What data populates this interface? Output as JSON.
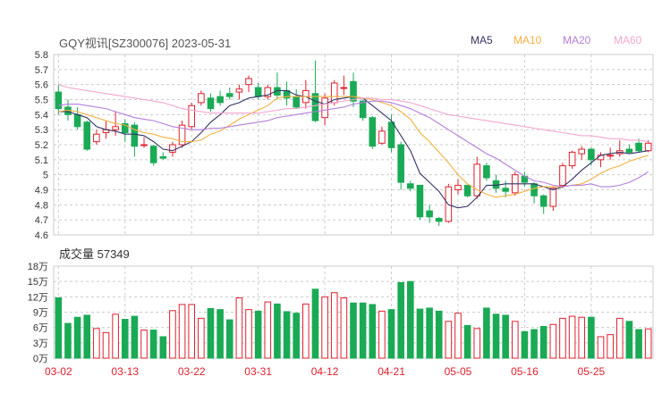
{
  "header": {
    "title": "GQY视讯[SZ300076] 2023-05-31",
    "ma_legend": [
      {
        "label": "MA5",
        "color": "#333366"
      },
      {
        "label": "MA10",
        "color": "#f5b041"
      },
      {
        "label": "MA20",
        "color": "#b57edc"
      },
      {
        "label": "MA60",
        "color": "#f4a6d0"
      }
    ]
  },
  "volume_header": {
    "label": "成交量 57349"
  },
  "colors": {
    "up": "#e0202e",
    "down": "#1aaa55",
    "grid": "#cccccc",
    "axis_text": "#333333",
    "date_text": "#e0202e"
  },
  "chart_data": [
    {
      "type": "candlestick",
      "title": "GQY视讯[SZ300076] 2023-05-31",
      "yticks": [
        "5.8",
        "5.7",
        "5.6",
        "5.5",
        "5.4",
        "5.3",
        "5.2",
        "5.1",
        "5",
        "4.9",
        "4.8",
        "4.7",
        "4.6"
      ],
      "ylim": [
        4.6,
        5.8
      ],
      "candles": [
        [
          5.55,
          5.44,
          5.6,
          5.4
        ],
        [
          5.45,
          5.4,
          5.5,
          5.36
        ],
        [
          5.4,
          5.32,
          5.45,
          5.3
        ],
        [
          5.35,
          5.17,
          5.36,
          5.16
        ],
        [
          5.22,
          5.27,
          5.3,
          5.2
        ],
        [
          5.28,
          5.3,
          5.36,
          5.24
        ],
        [
          5.3,
          5.32,
          5.42,
          5.26
        ],
        [
          5.34,
          5.28,
          5.37,
          5.22
        ],
        [
          5.33,
          5.19,
          5.35,
          5.12
        ],
        [
          5.2,
          5.2,
          5.25,
          5.18
        ],
        [
          5.19,
          5.08,
          5.2,
          5.06
        ],
        [
          5.12,
          5.11,
          5.15,
          5.1
        ],
        [
          5.15,
          5.2,
          5.22,
          5.12
        ],
        [
          5.2,
          5.33,
          5.36,
          5.18
        ],
        [
          5.32,
          5.46,
          5.48,
          5.3
        ],
        [
          5.48,
          5.54,
          5.56,
          5.46
        ],
        [
          5.51,
          5.44,
          5.54,
          5.42
        ],
        [
          5.52,
          5.48,
          5.56,
          5.46
        ],
        [
          5.54,
          5.52,
          5.58,
          5.5
        ],
        [
          5.55,
          5.57,
          5.6,
          5.5
        ],
        [
          5.6,
          5.64,
          5.66,
          5.55
        ],
        [
          5.58,
          5.52,
          5.61,
          5.5
        ],
        [
          5.52,
          5.58,
          5.6,
          5.5
        ],
        [
          5.58,
          5.53,
          5.68,
          5.5
        ],
        [
          5.56,
          5.51,
          5.62,
          5.46
        ],
        [
          5.52,
          5.45,
          5.57,
          5.44
        ],
        [
          5.48,
          5.56,
          5.63,
          5.44
        ],
        [
          5.54,
          5.36,
          5.76,
          5.35
        ],
        [
          5.38,
          5.51,
          5.54,
          5.33
        ],
        [
          5.48,
          5.61,
          5.63,
          5.46
        ],
        [
          5.58,
          5.58,
          5.66,
          5.53
        ],
        [
          5.62,
          5.49,
          5.68,
          5.45
        ],
        [
          5.49,
          5.38,
          5.5,
          5.36
        ],
        [
          5.38,
          5.19,
          5.39,
          5.17
        ],
        [
          5.21,
          5.29,
          5.32,
          5.2
        ],
        [
          5.35,
          5.18,
          5.4,
          5.15
        ],
        [
          5.2,
          4.95,
          5.22,
          4.9
        ],
        [
          4.94,
          4.91,
          4.96,
          4.89
        ],
        [
          4.93,
          4.72,
          4.93,
          4.7
        ],
        [
          4.76,
          4.72,
          4.8,
          4.68
        ],
        [
          4.71,
          4.69,
          4.72,
          4.66
        ],
        [
          4.69,
          4.92,
          4.94,
          4.68
        ],
        [
          4.9,
          4.93,
          4.97,
          4.87
        ],
        [
          4.93,
          4.86,
          4.93,
          4.85
        ],
        [
          4.86,
          5.07,
          5.12,
          4.84
        ],
        [
          5.06,
          4.98,
          5.08,
          4.96
        ],
        [
          4.96,
          4.91,
          5.0,
          4.88
        ],
        [
          4.91,
          4.89,
          4.96,
          4.85
        ],
        [
          4.88,
          5.0,
          5.02,
          4.86
        ],
        [
          4.99,
          4.95,
          5.02,
          4.92
        ],
        [
          4.94,
          4.86,
          4.95,
          4.81
        ],
        [
          4.86,
          4.79,
          4.87,
          4.74
        ],
        [
          4.79,
          4.91,
          4.92,
          4.76
        ],
        [
          4.93,
          5.06,
          5.08,
          4.91
        ],
        [
          5.06,
          5.15,
          5.16,
          5.04
        ],
        [
          5.14,
          5.17,
          5.19,
          5.1
        ],
        [
          5.17,
          5.1,
          5.18,
          5.06
        ],
        [
          5.1,
          5.13,
          5.15,
          5.05
        ],
        [
          5.13,
          5.13,
          5.18,
          5.1
        ],
        [
          5.14,
          5.16,
          5.23,
          5.12
        ],
        [
          5.17,
          5.15,
          5.2,
          5.14
        ],
        [
          5.21,
          5.16,
          5.24,
          5.15
        ],
        [
          5.16,
          5.21,
          5.23,
          5.15
        ]
      ],
      "ma5": [
        5.42,
        5.42,
        5.4,
        5.38,
        5.32,
        5.3,
        5.29,
        5.27,
        5.27,
        5.26,
        5.22,
        5.17,
        5.16,
        5.19,
        5.22,
        5.28,
        5.35,
        5.4,
        5.46,
        5.48,
        5.51,
        5.52,
        5.53,
        5.56,
        5.56,
        5.53,
        5.52,
        5.49,
        5.47,
        5.5,
        5.51,
        5.52,
        5.51,
        5.46,
        5.41,
        5.36,
        5.26,
        5.16,
        5.01,
        4.95,
        4.89,
        4.8,
        4.78,
        4.79,
        4.85,
        4.93,
        4.93,
        4.94,
        4.94,
        4.94,
        4.94,
        4.92,
        4.9,
        4.92,
        4.97,
        5.03,
        5.08,
        5.13,
        5.14,
        5.15,
        5.14,
        5.15,
        5.16
      ],
      "ma10": [
        5.42,
        5.43,
        5.42,
        5.4,
        5.38,
        5.36,
        5.34,
        5.33,
        5.3,
        5.28,
        5.27,
        5.25,
        5.24,
        5.22,
        5.22,
        5.23,
        5.27,
        5.29,
        5.33,
        5.37,
        5.4,
        5.43,
        5.46,
        5.51,
        5.52,
        5.52,
        5.52,
        5.52,
        5.52,
        5.52,
        5.52,
        5.52,
        5.51,
        5.5,
        5.48,
        5.46,
        5.42,
        5.37,
        5.28,
        5.22,
        5.15,
        5.08,
        5.0,
        4.94,
        4.9,
        4.87,
        4.85,
        4.86,
        4.87,
        4.89,
        4.91,
        4.92,
        4.92,
        4.92,
        4.93,
        4.94,
        4.97,
        5.01,
        5.04,
        5.06,
        5.09,
        5.11,
        5.13
      ],
      "ma20": [
        5.46,
        5.47,
        5.47,
        5.46,
        5.45,
        5.44,
        5.42,
        5.4,
        5.38,
        5.37,
        5.36,
        5.34,
        5.32,
        5.31,
        5.3,
        5.3,
        5.31,
        5.31,
        5.32,
        5.33,
        5.34,
        5.35,
        5.36,
        5.38,
        5.39,
        5.4,
        5.41,
        5.42,
        5.43,
        5.44,
        5.45,
        5.47,
        5.48,
        5.49,
        5.49,
        5.48,
        5.46,
        5.44,
        5.41,
        5.38,
        5.34,
        5.3,
        5.26,
        5.22,
        5.18,
        5.14,
        5.11,
        5.07,
        5.03,
        4.99,
        4.96,
        4.95,
        4.93,
        4.92,
        4.93,
        4.93,
        4.94,
        4.92,
        4.92,
        4.93,
        4.95,
        4.98,
        5.02
      ],
      "ma60": [
        5.6,
        5.58,
        5.57,
        5.56,
        5.55,
        5.54,
        5.53,
        5.52,
        5.51,
        5.5,
        5.49,
        5.48,
        5.46,
        5.44,
        5.43,
        5.42,
        5.41,
        5.41,
        5.41,
        5.41,
        5.41,
        5.41,
        5.42,
        5.43,
        5.44,
        5.44,
        5.45,
        5.46,
        5.47,
        5.48,
        5.49,
        5.5,
        5.51,
        5.51,
        5.5,
        5.5,
        5.49,
        5.48,
        5.46,
        5.44,
        5.42,
        5.4,
        5.39,
        5.38,
        5.37,
        5.36,
        5.35,
        5.34,
        5.33,
        5.32,
        5.31,
        5.3,
        5.29,
        5.28,
        5.27,
        5.26,
        5.26,
        5.25,
        5.24,
        5.24,
        5.23,
        5.23,
        5.22
      ]
    },
    {
      "type": "bar",
      "title": "成交量 57349",
      "yticks": [
        "18万",
        "15万",
        "12万",
        "9万",
        "6万",
        "3万",
        "0万"
      ],
      "ylim": [
        0,
        180000
      ],
      "categories": [
        "03-02",
        "03-13",
        "03-22",
        "03-31",
        "04-12",
        "04-21",
        "05-05",
        "05-16",
        "05-25"
      ],
      "values": [
        118000,
        68000,
        80000,
        84000,
        58000,
        50000,
        86000,
        76000,
        82000,
        55000,
        55000,
        42000,
        93000,
        105000,
        105000,
        78000,
        97000,
        95000,
        75000,
        118000,
        95000,
        92000,
        110000,
        106000,
        91000,
        88000,
        106000,
        135000,
        120000,
        128000,
        118000,
        108000,
        108000,
        105000,
        92000,
        95000,
        148000,
        150000,
        96000,
        98000,
        92000,
        72000,
        88000,
        64000,
        58000,
        98000,
        86000,
        84000,
        72000,
        52000,
        56000,
        62000,
        66000,
        78000,
        82000,
        80000,
        80000,
        42000,
        46000,
        78000,
        72000,
        56000,
        57349
      ]
    }
  ]
}
